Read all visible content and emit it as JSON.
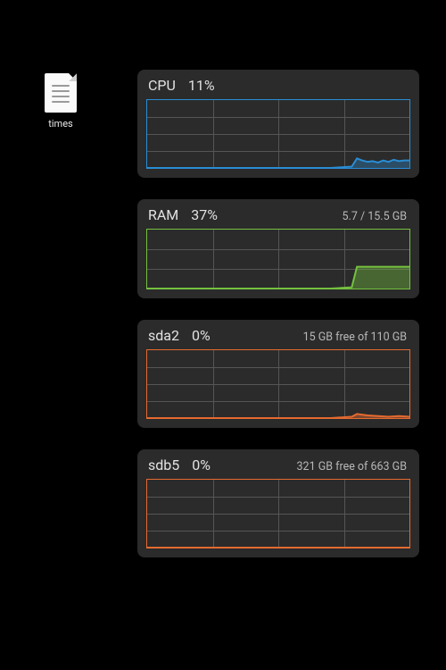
{
  "desktop": {
    "file": {
      "label": "times"
    }
  },
  "widgets": [
    {
      "name": "CPU",
      "value": "11%",
      "detail": "",
      "color": "blue",
      "chart_height": "tall"
    },
    {
      "name": "RAM",
      "value": "37%",
      "detail": "5.7 / 15.5 GB",
      "color": "green",
      "chart_height": ""
    },
    {
      "name": "sda2",
      "value": "0%",
      "detail": "15 GB free of 110 GB",
      "color": "orange",
      "chart_height": "tall"
    },
    {
      "name": "sdb5",
      "value": "0%",
      "detail": "321 GB free of 663 GB",
      "color": "orange",
      "chart_height": "tall"
    }
  ],
  "chart_data": [
    {
      "type": "area",
      "title": "CPU",
      "ylabel": "usage_pct",
      "ylim": [
        0,
        100
      ],
      "x": [
        0,
        10,
        20,
        30,
        40,
        50,
        60,
        70,
        78,
        80,
        82,
        84,
        86,
        88,
        90,
        92,
        94,
        96,
        98,
        100
      ],
      "values": [
        0,
        0,
        0,
        0,
        0,
        0,
        0,
        0,
        2,
        14,
        11,
        9,
        10,
        8,
        11,
        9,
        12,
        10,
        11,
        11
      ],
      "stroke": "#2a8dd4",
      "fill": "rgba(42,141,212,0.35)"
    },
    {
      "type": "area",
      "title": "RAM",
      "ylabel": "usage_pct",
      "ylim": [
        0,
        100
      ],
      "x": [
        0,
        10,
        20,
        30,
        40,
        50,
        60,
        70,
        78,
        80,
        85,
        90,
        95,
        100
      ],
      "values": [
        0,
        0,
        0,
        0,
        0,
        0,
        0,
        0,
        2,
        37,
        37,
        37,
        37,
        37
      ],
      "stroke": "#74c13f",
      "fill": "rgba(116,193,63,0.40)"
    },
    {
      "type": "area",
      "title": "sda2",
      "ylabel": "io_pct",
      "ylim": [
        0,
        100
      ],
      "x": [
        0,
        10,
        20,
        30,
        40,
        50,
        60,
        70,
        78,
        80,
        84,
        88,
        92,
        96,
        100
      ],
      "values": [
        0,
        0,
        0,
        0,
        0,
        0,
        0,
        0,
        2,
        6,
        4,
        3,
        2,
        3,
        2
      ],
      "stroke": "#e46a30",
      "fill": "rgba(228,106,48,0.45)"
    },
    {
      "type": "area",
      "title": "sdb5",
      "ylabel": "io_pct",
      "ylim": [
        0,
        100
      ],
      "x": [
        0,
        100
      ],
      "values": [
        0,
        0
      ],
      "stroke": "#e46a30",
      "fill": "rgba(228,106,48,0.45)"
    }
  ]
}
